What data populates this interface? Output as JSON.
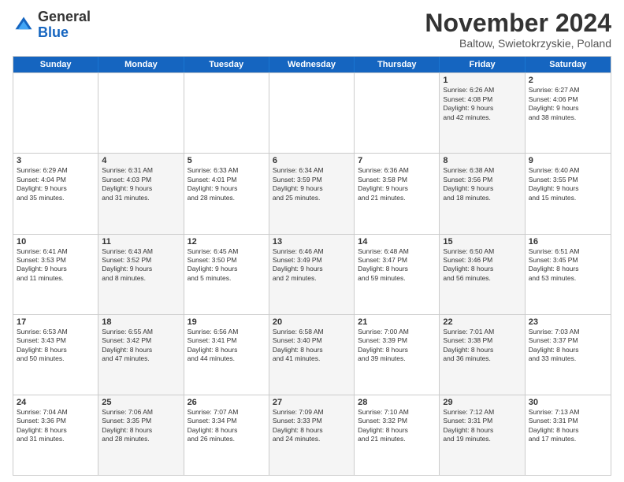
{
  "logo": {
    "general": "General",
    "blue": "Blue"
  },
  "header": {
    "month": "November 2024",
    "location": "Baltow, Swietokrzyskie, Poland"
  },
  "days_of_week": [
    "Sunday",
    "Monday",
    "Tuesday",
    "Wednesday",
    "Thursday",
    "Friday",
    "Saturday"
  ],
  "weeks": [
    [
      {
        "day": "",
        "info": "",
        "empty": true
      },
      {
        "day": "",
        "info": "",
        "empty": true
      },
      {
        "day": "",
        "info": "",
        "empty": true
      },
      {
        "day": "",
        "info": "",
        "empty": true
      },
      {
        "day": "",
        "info": "",
        "empty": true
      },
      {
        "day": "1",
        "info": "Sunrise: 6:26 AM\nSunset: 4:08 PM\nDaylight: 9 hours\nand 42 minutes.",
        "shaded": true
      },
      {
        "day": "2",
        "info": "Sunrise: 6:27 AM\nSunset: 4:06 PM\nDaylight: 9 hours\nand 38 minutes.",
        "shaded": false
      }
    ],
    [
      {
        "day": "3",
        "info": "Sunrise: 6:29 AM\nSunset: 4:04 PM\nDaylight: 9 hours\nand 35 minutes.",
        "shaded": false
      },
      {
        "day": "4",
        "info": "Sunrise: 6:31 AM\nSunset: 4:03 PM\nDaylight: 9 hours\nand 31 minutes.",
        "shaded": true
      },
      {
        "day": "5",
        "info": "Sunrise: 6:33 AM\nSunset: 4:01 PM\nDaylight: 9 hours\nand 28 minutes.",
        "shaded": false
      },
      {
        "day": "6",
        "info": "Sunrise: 6:34 AM\nSunset: 3:59 PM\nDaylight: 9 hours\nand 25 minutes.",
        "shaded": true
      },
      {
        "day": "7",
        "info": "Sunrise: 6:36 AM\nSunset: 3:58 PM\nDaylight: 9 hours\nand 21 minutes.",
        "shaded": false
      },
      {
        "day": "8",
        "info": "Sunrise: 6:38 AM\nSunset: 3:56 PM\nDaylight: 9 hours\nand 18 minutes.",
        "shaded": true
      },
      {
        "day": "9",
        "info": "Sunrise: 6:40 AM\nSunset: 3:55 PM\nDaylight: 9 hours\nand 15 minutes.",
        "shaded": false
      }
    ],
    [
      {
        "day": "10",
        "info": "Sunrise: 6:41 AM\nSunset: 3:53 PM\nDaylight: 9 hours\nand 11 minutes.",
        "shaded": false
      },
      {
        "day": "11",
        "info": "Sunrise: 6:43 AM\nSunset: 3:52 PM\nDaylight: 9 hours\nand 8 minutes.",
        "shaded": true
      },
      {
        "day": "12",
        "info": "Sunrise: 6:45 AM\nSunset: 3:50 PM\nDaylight: 9 hours\nand 5 minutes.",
        "shaded": false
      },
      {
        "day": "13",
        "info": "Sunrise: 6:46 AM\nSunset: 3:49 PM\nDaylight: 9 hours\nand 2 minutes.",
        "shaded": true
      },
      {
        "day": "14",
        "info": "Sunrise: 6:48 AM\nSunset: 3:47 PM\nDaylight: 8 hours\nand 59 minutes.",
        "shaded": false
      },
      {
        "day": "15",
        "info": "Sunrise: 6:50 AM\nSunset: 3:46 PM\nDaylight: 8 hours\nand 56 minutes.",
        "shaded": true
      },
      {
        "day": "16",
        "info": "Sunrise: 6:51 AM\nSunset: 3:45 PM\nDaylight: 8 hours\nand 53 minutes.",
        "shaded": false
      }
    ],
    [
      {
        "day": "17",
        "info": "Sunrise: 6:53 AM\nSunset: 3:43 PM\nDaylight: 8 hours\nand 50 minutes.",
        "shaded": false
      },
      {
        "day": "18",
        "info": "Sunrise: 6:55 AM\nSunset: 3:42 PM\nDaylight: 8 hours\nand 47 minutes.",
        "shaded": true
      },
      {
        "day": "19",
        "info": "Sunrise: 6:56 AM\nSunset: 3:41 PM\nDaylight: 8 hours\nand 44 minutes.",
        "shaded": false
      },
      {
        "day": "20",
        "info": "Sunrise: 6:58 AM\nSunset: 3:40 PM\nDaylight: 8 hours\nand 41 minutes.",
        "shaded": true
      },
      {
        "day": "21",
        "info": "Sunrise: 7:00 AM\nSunset: 3:39 PM\nDaylight: 8 hours\nand 39 minutes.",
        "shaded": false
      },
      {
        "day": "22",
        "info": "Sunrise: 7:01 AM\nSunset: 3:38 PM\nDaylight: 8 hours\nand 36 minutes.",
        "shaded": true
      },
      {
        "day": "23",
        "info": "Sunrise: 7:03 AM\nSunset: 3:37 PM\nDaylight: 8 hours\nand 33 minutes.",
        "shaded": false
      }
    ],
    [
      {
        "day": "24",
        "info": "Sunrise: 7:04 AM\nSunset: 3:36 PM\nDaylight: 8 hours\nand 31 minutes.",
        "shaded": false
      },
      {
        "day": "25",
        "info": "Sunrise: 7:06 AM\nSunset: 3:35 PM\nDaylight: 8 hours\nand 28 minutes.",
        "shaded": true
      },
      {
        "day": "26",
        "info": "Sunrise: 7:07 AM\nSunset: 3:34 PM\nDaylight: 8 hours\nand 26 minutes.",
        "shaded": false
      },
      {
        "day": "27",
        "info": "Sunrise: 7:09 AM\nSunset: 3:33 PM\nDaylight: 8 hours\nand 24 minutes.",
        "shaded": true
      },
      {
        "day": "28",
        "info": "Sunrise: 7:10 AM\nSunset: 3:32 PM\nDaylight: 8 hours\nand 21 minutes.",
        "shaded": false
      },
      {
        "day": "29",
        "info": "Sunrise: 7:12 AM\nSunset: 3:31 PM\nDaylight: 8 hours\nand 19 minutes.",
        "shaded": true
      },
      {
        "day": "30",
        "info": "Sunrise: 7:13 AM\nSunset: 3:31 PM\nDaylight: 8 hours\nand 17 minutes.",
        "shaded": false
      }
    ]
  ]
}
